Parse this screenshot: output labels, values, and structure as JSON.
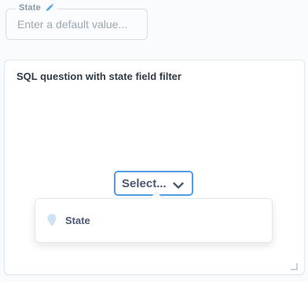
{
  "parameter": {
    "label": "State",
    "placeholder": "Enter a default value...",
    "edit_icon": "pencil-icon"
  },
  "card": {
    "title": "SQL question with state field filter",
    "select_label": "Select...",
    "select_icon": "chevron-down-icon",
    "dropdown": {
      "items": [
        {
          "label": "State",
          "icon": "location-pin-icon"
        }
      ]
    },
    "resize_icon": "resize-corner-icon"
  },
  "colors": {
    "accent": "#509ee3",
    "text": "#4c5773",
    "muted": "#9aa8b4",
    "pin": "#cde3f3"
  }
}
